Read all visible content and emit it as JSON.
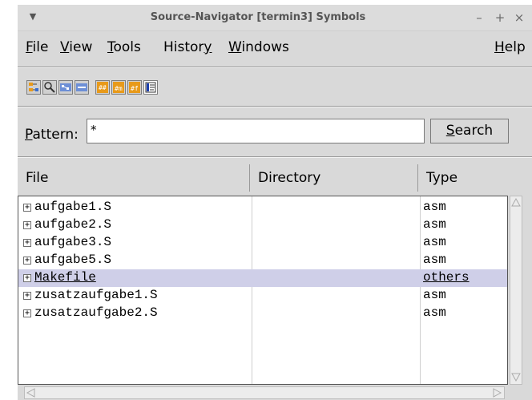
{
  "window": {
    "title": "Source-Navigator [termin3] Symbols",
    "controls": {
      "minimize": "–",
      "maximize": "+",
      "close": "×"
    }
  },
  "menubar": {
    "file": {
      "mnemonic": "F",
      "rest": "ile"
    },
    "view": {
      "mnemonic": "V",
      "rest": "iew"
    },
    "tools": {
      "mnemonic": "T",
      "rest": "ools"
    },
    "history": {
      "before": "Histor",
      "mnemonic": "y"
    },
    "windows": {
      "mnemonic": "W",
      "rest": "indows"
    },
    "help": {
      "mnemonic": "H",
      "rest": "elp"
    }
  },
  "toolbar": {
    "icons": [
      "class-browser-icon",
      "retriever-icon",
      "xref-icon",
      "include-icon",
      "grep-icon",
      "symbols-icon",
      "functions-icon",
      "editor-icon"
    ]
  },
  "pattern": {
    "label_mnemonic": "P",
    "label_rest": "attern:",
    "value": "*"
  },
  "search": {
    "mnemonic": "S",
    "rest": "earch"
  },
  "columns": {
    "file": "File",
    "directory": "Directory",
    "type": "Type"
  },
  "rows": [
    {
      "file": "aufgabe1.S",
      "directory": "",
      "type": "asm",
      "expander": "+"
    },
    {
      "file": "aufgabe2.S",
      "directory": "",
      "type": "asm",
      "expander": "+"
    },
    {
      "file": "aufgabe3.S",
      "directory": "",
      "type": "asm",
      "expander": "+"
    },
    {
      "file": "aufgabe5.S",
      "directory": "",
      "type": "asm",
      "expander": "+"
    },
    {
      "file": "Makefile",
      "directory": "",
      "type": "others",
      "expander": "+",
      "selected": true
    },
    {
      "file": "zusatzaufgabe1.S",
      "directory": "",
      "type": "asm",
      "expander": "+"
    },
    {
      "file": "zusatzaufgabe2.S",
      "directory": "",
      "type": "asm",
      "expander": "+"
    }
  ],
  "colors": {
    "selection": "#cfcfe8",
    "toolbar_icon_accent": "#e89a1a"
  }
}
